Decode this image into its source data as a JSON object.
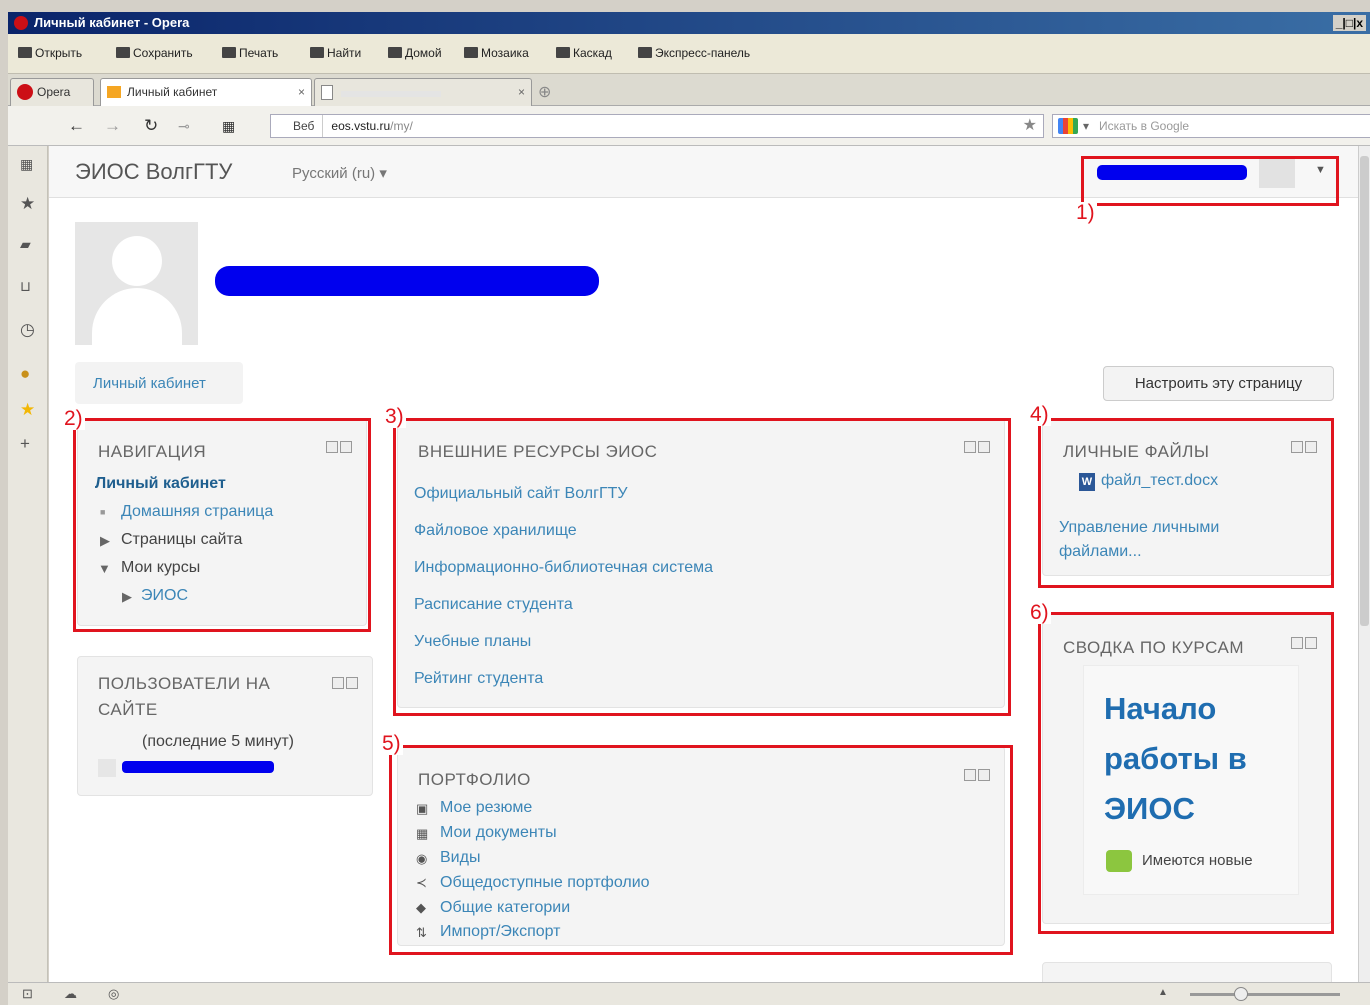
{
  "window": {
    "title": "Личный кабинет - Opera",
    "controls": "_|□|x"
  },
  "menu": [
    "Открыть",
    "Сохранить",
    "Печать",
    "Найти",
    "Домой",
    "Мозаика",
    "Каскад",
    "Экспресс-панель"
  ],
  "tabs": {
    "opera": "Opera",
    "active": "Личный кабинет",
    "blank": ""
  },
  "address": {
    "sec": "Веб",
    "url_host": "eos.vstu.ru",
    "url_path": "/my/",
    "search_placeholder": "Искать в Google"
  },
  "site": {
    "brand": "ЭИОС ВолгГТУ",
    "language": "Русский (ru) ▾"
  },
  "breadcrumb": "Личный кабинет",
  "customize_button": "Настроить эту страницу",
  "navigation": {
    "title": "НАВИГАЦИЯ",
    "root": "Личный кабинет",
    "items": [
      "Домашняя страница",
      "Страницы сайта",
      "Мои курсы",
      "ЭИОС"
    ]
  },
  "online_users": {
    "title_line1": "ПОЛЬЗОВАТЕЛИ НА",
    "title_line2": "САЙТЕ",
    "period": "(последние 5 минут)"
  },
  "external": {
    "title": "ВНЕШНИЕ РЕСУРСЫ ЭИОС",
    "links": [
      "Официальный сайт ВолгГТУ",
      "Файловое хранилище",
      "Информационно-библиотечная система",
      "Расписание студента",
      "Учебные планы",
      "Рейтинг студента"
    ]
  },
  "portfolio": {
    "title": "ПОРТФОЛИО",
    "links": [
      "Мое резюме",
      "Мои документы",
      "Виды",
      "Общедоступные портфолио",
      "Общие категории",
      "Импорт/Экспорт"
    ]
  },
  "private_files": {
    "title": "ЛИЧНЫЕ ФАЙЛЫ",
    "file": "файл_тест.docx",
    "manage_line1": "Управление личными",
    "manage_line2": "файлами..."
  },
  "course_overview": {
    "title": "СВОДКА ПО КУРСАМ",
    "course_line1": "Начало",
    "course_line2": "работы в",
    "course_line3": "ЭИОС",
    "news": "Имеются новые"
  },
  "annotations": [
    "1)",
    "2)",
    "3)",
    "4)",
    "5)",
    "6)"
  ],
  "colors": {
    "link": "#3c86b7",
    "highlight": "#e0141e",
    "redaction": "#0000ee"
  }
}
